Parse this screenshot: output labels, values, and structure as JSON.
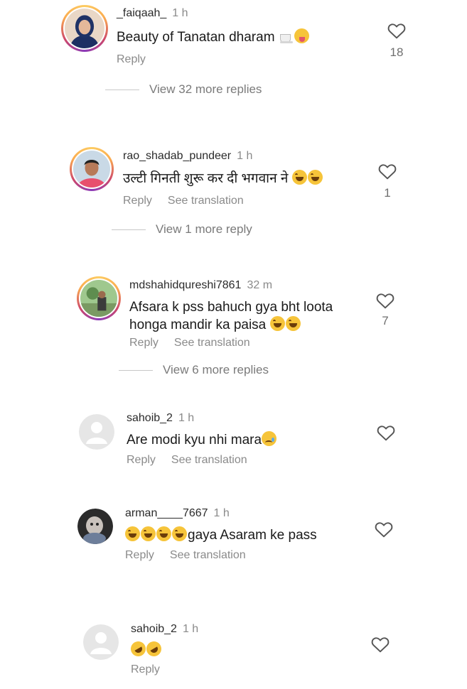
{
  "comments": [
    {
      "username": "_faiqaah_",
      "time": "1 h",
      "text": "Beauty of Tanatan dharam ",
      "emojis": [
        "cup",
        "tongue"
      ],
      "reply": "Reply",
      "likes": "18",
      "more_replies": "View 32 more replies"
    },
    {
      "username": "rao_shadab_pundeer",
      "time": "1 h",
      "text": "उल्टी गिनती शुरू कर दी भगवान ने ",
      "emojis": [
        "laugh",
        "laugh"
      ],
      "reply": "Reply",
      "translation": "See translation",
      "likes": "1",
      "more_replies": "View 1 more reply"
    },
    {
      "username": "mdshahidqureshi7861",
      "time": "32 m",
      "text": "Afsara k pss bahuch gya bht loota\nhonga mandir ka paisa ",
      "emojis": [
        "laugh",
        "laugh"
      ],
      "reply": "Reply",
      "translation": "See translation",
      "likes": "7",
      "more_replies": "View 6 more replies"
    },
    {
      "username": "sahoib_2",
      "time": "1 h",
      "text": "Are modi kyu nhi mara",
      "emojis": [
        "cry"
      ],
      "reply": "Reply",
      "translation": "See translation"
    },
    {
      "username": "arman____7667",
      "time": "1 h",
      "text_prefix_emojis": [
        "laugh",
        "laugh",
        "laugh",
        "laugh"
      ],
      "text": "gaya Asaram ke pass",
      "reply": "Reply",
      "translation": "See translation"
    },
    {
      "username": "sahoib_2",
      "time": "1 h",
      "text": "",
      "emojis": [
        "rofl",
        "rofl"
      ],
      "reply": "Reply"
    }
  ]
}
